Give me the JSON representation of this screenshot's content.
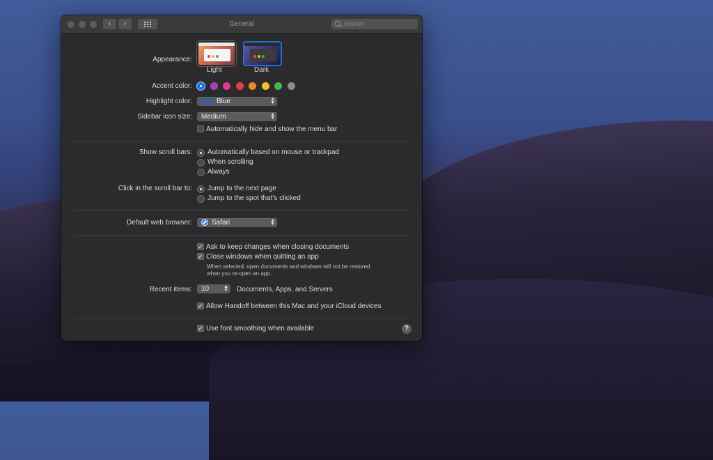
{
  "window": {
    "title": "General"
  },
  "toolbar": {
    "back_icon": "chevron-left-icon",
    "forward_icon": "chevron-right-icon",
    "grid_icon": "show-all-grid-icon",
    "search_placeholder": "Search"
  },
  "appearance": {
    "label": "Appearance:",
    "options": [
      "Light",
      "Dark"
    ],
    "selected": "Dark"
  },
  "accent": {
    "label": "Accent color:",
    "colors": [
      "#1f6fe5",
      "#a940b8",
      "#e23b8c",
      "#e0404a",
      "#f08a24",
      "#f5c228",
      "#48b84c",
      "#8c8c8c"
    ],
    "selected_index": 0
  },
  "highlight": {
    "label": "Highlight color:",
    "value": "Blue"
  },
  "sidebar_icon": {
    "label": "Sidebar icon size:",
    "value": "Medium"
  },
  "menu_bar": {
    "label": "Automatically hide and show the menu bar",
    "checked": false
  },
  "scroll_bars": {
    "label": "Show scroll bars:",
    "options": [
      "Automatically based on mouse or trackpad",
      "When scrolling",
      "Always"
    ],
    "selected_index": 0
  },
  "scroll_click": {
    "label": "Click in the scroll bar to:",
    "options": [
      "Jump to the next page",
      "Jump to the spot that’s clicked"
    ],
    "selected_index": 0
  },
  "browser": {
    "label": "Default web browser:",
    "value": "Safari"
  },
  "documents": {
    "ask_keep": "Ask to keep changes when closing documents",
    "close_windows": "Close windows when quitting an app",
    "note_line1": "When selected, open documents and windows will not be restored",
    "note_line2": "when you re-open an app."
  },
  "recent": {
    "label": "Recent items:",
    "value": "10",
    "suffix": "Documents, Apps, and Servers"
  },
  "handoff": "Allow Handoff between this Mac and your iCloud devices",
  "font_smoothing": "Use font smoothing when available",
  "help": "?"
}
